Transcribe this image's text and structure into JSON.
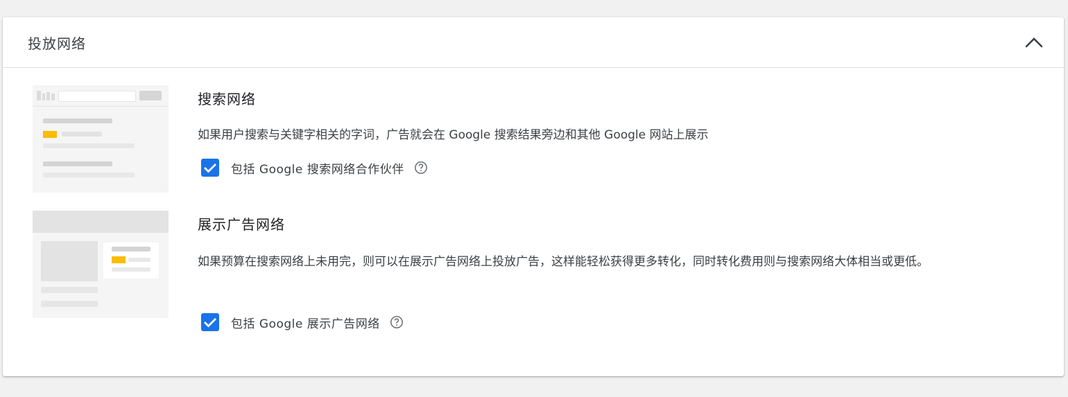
{
  "panel": {
    "title": "投放网络",
    "collapse_icon": "chevron-up-icon"
  },
  "sections": [
    {
      "title": "搜索网络",
      "description": "如果用户搜索与关键字相关的字词，广告就会在 Google 搜索结果旁边和其他 Google 网站上展示",
      "checkbox_label": "包括 Google 搜索网络合作伙伴",
      "checked": true,
      "help_icon": "help-circle-icon"
    },
    {
      "title": "展示广告网络",
      "description": "如果预算在搜索网络上未用完，则可以在展示广告网络上投放广告，这样能轻松获得更多转化，同时转化费用则与搜索网络大体相当或更低。",
      "checkbox_label": "包括 Google 展示广告网络",
      "checked": true,
      "help_icon": "help-circle-icon"
    }
  ],
  "colors": {
    "checkbox": "#1a73e8",
    "highlight": "#fbbc04",
    "illustration_bg": "#f5f5f5"
  }
}
